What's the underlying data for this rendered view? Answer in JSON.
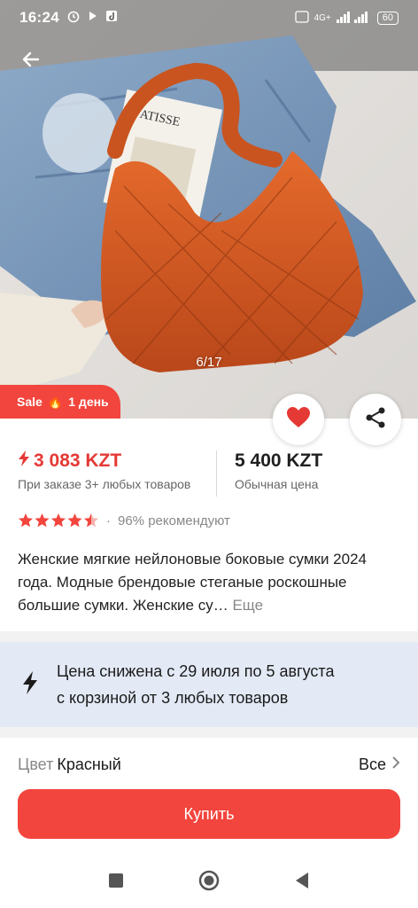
{
  "status_bar": {
    "time": "16:24",
    "net_label": "4G+",
    "battery": "60"
  },
  "gallery": {
    "counter": "6/17",
    "sale_badge": {
      "sale": "Sale",
      "fire": "🔥",
      "duration": "1 день"
    }
  },
  "price": {
    "sale_price": "3 083 KZT",
    "sale_note": "При заказе 3+ любых товаров",
    "regular_price": "5 400 KZT",
    "regular_note": "Обычная цена"
  },
  "rating": {
    "stars": 4.5,
    "recommend": "96% рекомендуют"
  },
  "product": {
    "title": "Женские мягкие нейлоновые боковые сумки 2024 года. Модные брендовые стеганые роскошные большие сумки. Женские су…",
    "more": "Еще"
  },
  "promo": {
    "line1": "Цена снижена с 29 июля по 5 августа",
    "line2": "с корзиной от 3 любых товаров"
  },
  "color": {
    "label": "Цвет",
    "value": "Красный",
    "all": "Все"
  },
  "buy_label": "Купить",
  "colors": {
    "accent": "#f2453d",
    "price_red": "#e53935",
    "promo_bg": "#e3eaf6"
  }
}
